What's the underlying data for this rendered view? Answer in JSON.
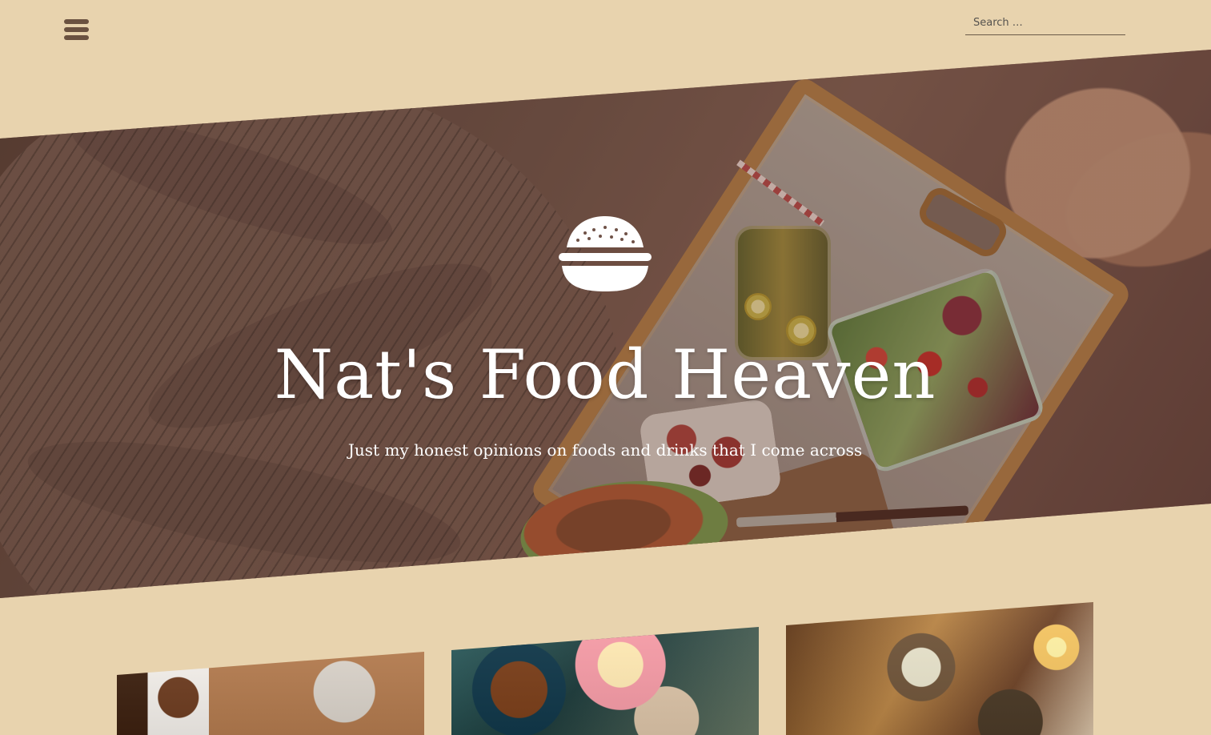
{
  "header": {
    "menu_icon": "hamburger-menu-icon",
    "search": {
      "placeholder": "Search …",
      "value": ""
    }
  },
  "hero": {
    "logo_icon": "burger-icon",
    "title": "Nat's Food Heaven",
    "tagline": "Just my honest opinions on foods and drinks that I come across"
  },
  "posts": [
    {
      "image": "food-post-image"
    },
    {
      "image": "food-post-image"
    },
    {
      "image": "food-post-image"
    }
  ],
  "colors": {
    "background": "#e8d3ae",
    "menu": "#6a5140",
    "title": "#ffffff"
  }
}
